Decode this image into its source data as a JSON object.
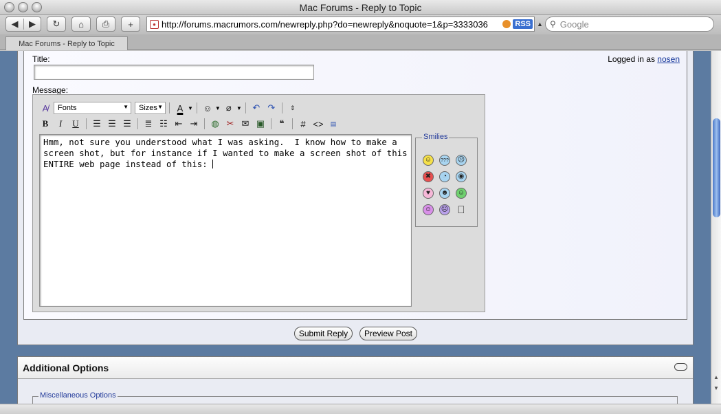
{
  "window": {
    "title": "Mac Forums - Reply to Topic"
  },
  "toolbar": {
    "back_icon": "◀",
    "forward_icon": "▶",
    "reload_icon": "↻",
    "home_icon": "⌂",
    "print_icon": "⎙",
    "add_icon": "+",
    "url": "http://forums.macrumors.com/newreply.php?do=newreply&noquote=1&p=3333036",
    "rss_label": "RSS",
    "search_placeholder": "Google"
  },
  "tab": {
    "label": "Mac Forums - Reply to Topic"
  },
  "form": {
    "title_label": "Title:",
    "title_value": "",
    "logged_in_prefix": "Logged in as",
    "username": "nosen",
    "message_label": "Message:"
  },
  "editor": {
    "font_select": "Fonts",
    "size_select": "Sizes",
    "message_text": "Hmm, not sure you understood what I was asking.  I know how to make a screen shot, but for instance if I wanted to make a screen shot of this ENTIRE web page instead of this: ",
    "smilies_label": "Smilies",
    "smilies": [
      "☺",
      "???",
      "☹",
      "✖",
      "◔",
      "◉",
      "♥",
      "☻",
      "☺",
      "☺",
      "☹",
      ""
    ]
  },
  "buttons": {
    "submit": "Submit Reply",
    "preview": "Preview Post"
  },
  "additional": {
    "title": "Additional Options",
    "misc_legend": "Miscellaneous Options"
  },
  "colors": {
    "page_bg": "#5c7ba1",
    "link": "#113399",
    "legend": "#223a9a"
  }
}
